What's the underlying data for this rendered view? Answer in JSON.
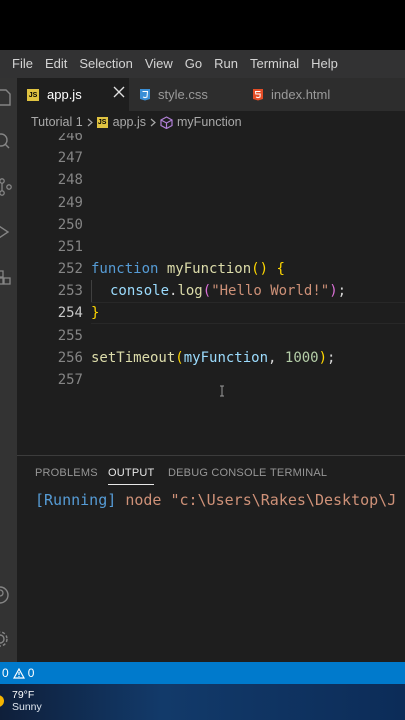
{
  "menu": [
    "File",
    "Edit",
    "Selection",
    "View",
    "Go",
    "Run",
    "Terminal",
    "Help"
  ],
  "tabs": [
    {
      "label": "app.js",
      "icon": "js-file-icon",
      "active": true
    },
    {
      "label": "style.css",
      "icon": "css-file-icon",
      "active": false
    },
    {
      "label": "index.html",
      "icon": "html-file-icon",
      "active": false
    }
  ],
  "tab_badge_js": "JS",
  "breadcrumb": {
    "folder": "Tutorial 1",
    "file": "app.js",
    "symbol": "myFunction"
  },
  "editor": {
    "line_numbers": [
      "246",
      "247",
      "248",
      "249",
      "250",
      "251",
      "252",
      "253",
      "254",
      "255",
      "256",
      "257"
    ],
    "current_line": "254",
    "code": {
      "l252_kw": "function",
      "l252_fn": "myFunction",
      "l252_paren": "()",
      "l252_brace": "{",
      "l253_obj": "console",
      "l253_dot": ".",
      "l253_fn": "log",
      "l253_open": "(",
      "l253_str": "\"Hello World!\"",
      "l253_close": ")",
      "l253_semi": ";",
      "l254_brace": "}",
      "l256_fn": "setTimeout",
      "l256_open": "(",
      "l256_arg": "myFunction",
      "l256_comma": ", ",
      "l256_num": "1000",
      "l256_close": ")",
      "l256_semi": ";"
    }
  },
  "panel": {
    "tabs": [
      "PROBLEMS",
      "OUTPUT",
      "DEBUG CONSOLE",
      "TERMINAL"
    ],
    "active_tab": "OUTPUT",
    "output_tag": "[Running]",
    "output_cmd": "node \"c:\\Users\\Rakes\\Desktop\\J"
  },
  "statusbar": {
    "errors": "0",
    "warnings": "0"
  },
  "taskbar": {
    "temperature": "79°F",
    "condition": "Sunny"
  },
  "colors": {
    "statusbar": "#007acc",
    "keyword": "#569cd6",
    "function": "#dcdcaa",
    "string": "#ce9178",
    "number": "#b5cea8",
    "output_running": "#569cd6",
    "output_command": "#ce9178"
  }
}
